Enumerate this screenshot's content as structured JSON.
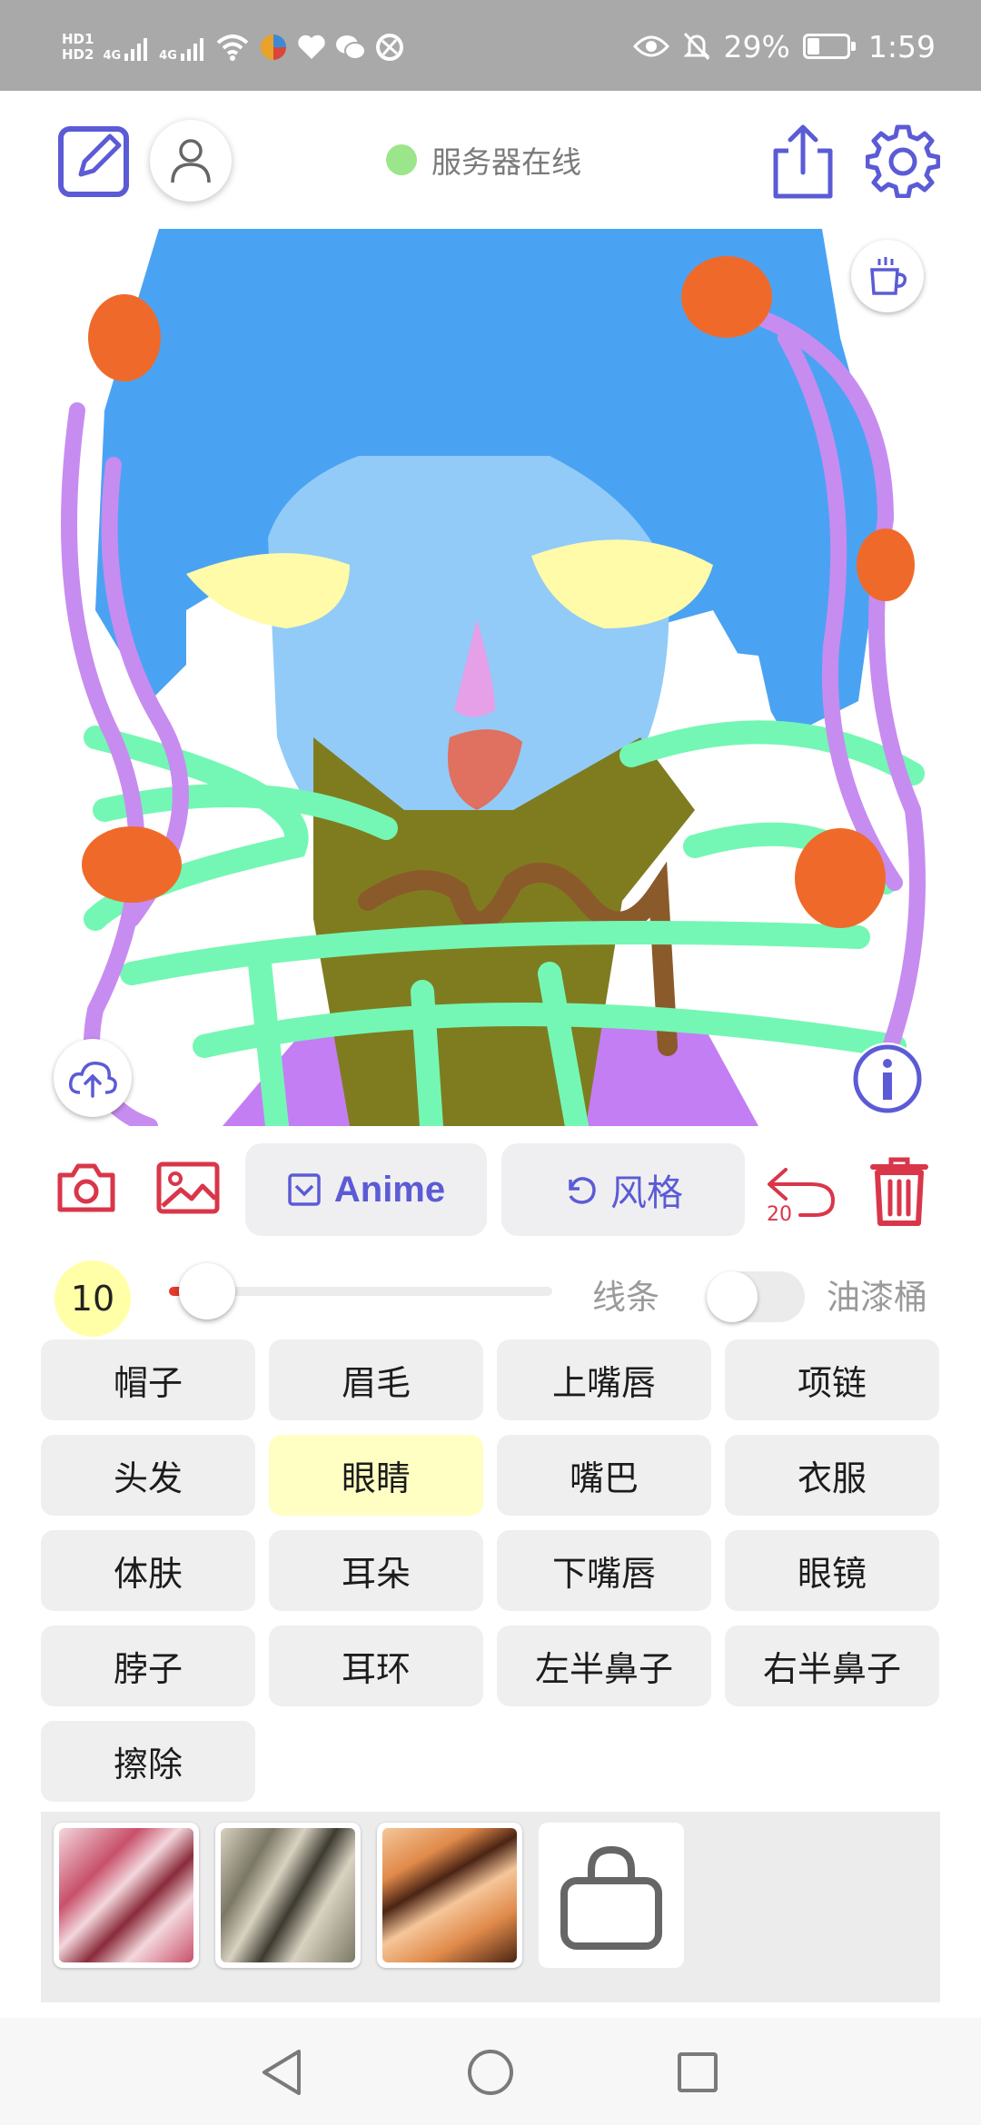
{
  "status_bar": {
    "hd1": "HD1",
    "hd2": "HD2",
    "sig1": "4G",
    "sig2": "4G",
    "battery_pct": "29%",
    "battery_level": 0.29,
    "time": "1:59"
  },
  "header": {
    "server_status": "服务器在线",
    "server_status_color": "#9be68a",
    "accent": "#5b5bd6"
  },
  "canvas": {
    "background": "#ffffff"
  },
  "tools": {
    "anime_label": "Anime",
    "style_label": "风格",
    "undo_count": "20",
    "danger_color": "#d9364a"
  },
  "brush": {
    "size": "10",
    "slider_fraction": 0.1,
    "line_label": "线条",
    "fill_label": "油漆桶",
    "fill_enabled": false
  },
  "categories": [
    {
      "label": "帽子",
      "active": false
    },
    {
      "label": "眉毛",
      "active": false
    },
    {
      "label": "上嘴唇",
      "active": false
    },
    {
      "label": "项链",
      "active": false
    },
    {
      "label": "头发",
      "active": false
    },
    {
      "label": "眼睛",
      "active": true
    },
    {
      "label": "嘴巴",
      "active": false
    },
    {
      "label": "衣服",
      "active": false
    },
    {
      "label": "体肤",
      "active": false
    },
    {
      "label": "耳朵",
      "active": false
    },
    {
      "label": "下嘴唇",
      "active": false
    },
    {
      "label": "眼镜",
      "active": false
    },
    {
      "label": "脖子",
      "active": false
    },
    {
      "label": "耳环",
      "active": false
    },
    {
      "label": "左半鼻子",
      "active": false
    },
    {
      "label": "右半鼻子",
      "active": false
    },
    {
      "label": "擦除",
      "active": false
    }
  ],
  "style_thumbs": [
    {
      "name": "style-1",
      "colors": [
        "#c8506a",
        "#f3d7dc",
        "#8a2a3a"
      ]
    },
    {
      "name": "style-2",
      "colors": [
        "#7c7866",
        "#d8d2c0",
        "#3d3a30"
      ]
    },
    {
      "name": "style-3",
      "colors": [
        "#e08a4a",
        "#f5c69a",
        "#4b2414"
      ]
    }
  ]
}
